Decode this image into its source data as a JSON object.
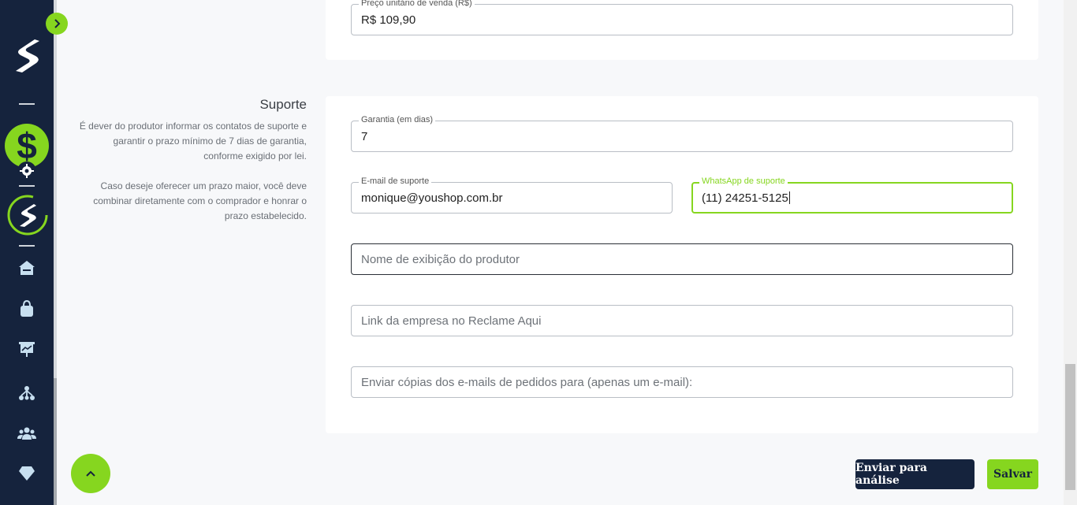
{
  "sidebar": {
    "toggle_icon": "chevron-right-icon",
    "logo": "brand-s-logo",
    "items": [
      {
        "name": "sales-dollar-icon"
      },
      {
        "name": "settings-gear-icon"
      },
      {
        "name": "brand-ring-icon"
      },
      {
        "name": "home-icon"
      },
      {
        "name": "shopping-bag-icon"
      },
      {
        "name": "presentation-chart-icon"
      },
      {
        "name": "network-icon"
      },
      {
        "name": "users-icon"
      },
      {
        "name": "diamond-icon"
      }
    ],
    "accent": "#86d61f",
    "background": "#15233d"
  },
  "price": {
    "label": "Preço unitário de venda (R$)",
    "value": "R$ 109,90"
  },
  "support": {
    "title": "Suporte",
    "desc_1": "É dever do produtor informar os contatos de suporte e garantir o prazo mínimo de 7 dias de garantia, conforme exigido por lei.",
    "desc_2": "Caso deseje oferecer um prazo maior, você deve combinar diretamente com o comprador e honrar o prazo estabelecido.",
    "warranty": {
      "label": "Garantia (em dias)",
      "value": "7"
    },
    "email": {
      "label": "E-mail de suporte",
      "value": "monique@youshop.com.br"
    },
    "whatsapp": {
      "label": "WhatsApp de suporte",
      "value": "(11) 24251-5125"
    },
    "display_name": {
      "placeholder": "Nome de exibição do produtor"
    },
    "reclame_aqui": {
      "placeholder": "Link da empresa no Reclame Aqui"
    },
    "copies_email": {
      "placeholder": "Enviar cópias dos e-mails de pedidos para (apenas um e-mail):"
    }
  },
  "actions": {
    "submit_label": "Enviar para análise",
    "save_label": "Salvar"
  }
}
